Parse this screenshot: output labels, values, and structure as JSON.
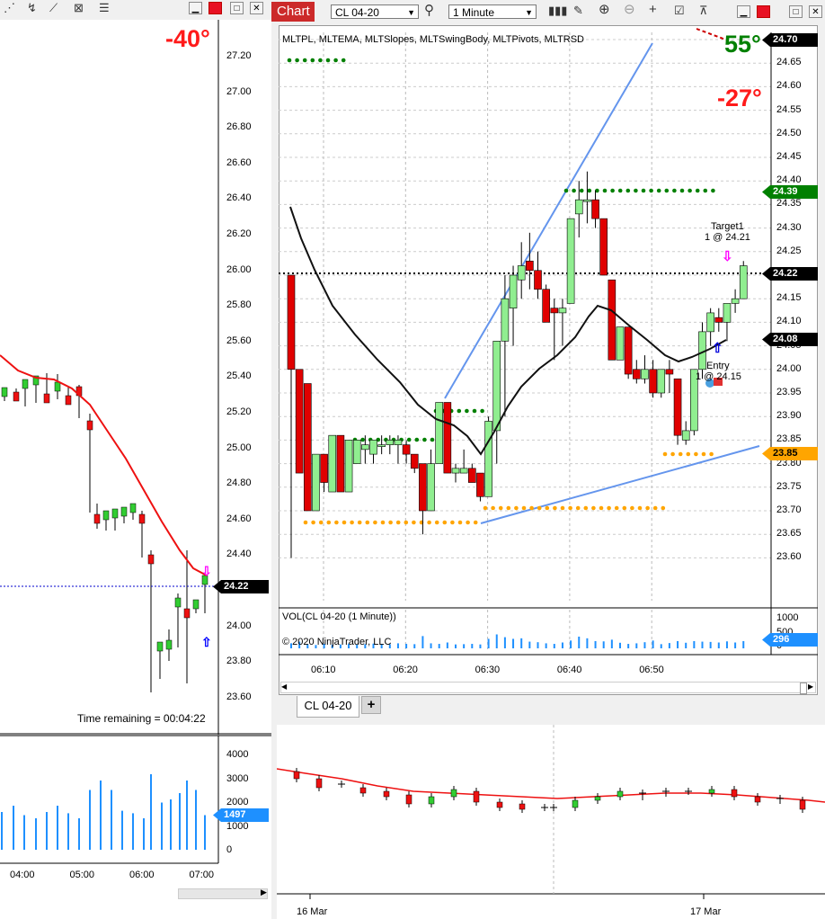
{
  "left_chart": {
    "angle": "-40°",
    "y_ticks": [
      "27.20",
      "27.00",
      "26.80",
      "26.60",
      "26.40",
      "26.20",
      "26.00",
      "25.80",
      "25.60",
      "25.40",
      "25.20",
      "25.00",
      "24.80",
      "24.60",
      "24.40",
      "24.20",
      "24.00",
      "23.80",
      "23.60"
    ],
    "price_label": "24.22",
    "time_remaining": "Time remaining = 00:04:22",
    "vol_ticks": [
      "4000",
      "3000",
      "2000",
      "1000",
      "0"
    ],
    "vol_label": "1497",
    "x_ticks": [
      "04:00",
      "05:00",
      "06:00",
      "07:00"
    ]
  },
  "main_chart": {
    "tab_title": "Chart",
    "instrument": "CL 04-20",
    "interval": "1 Minute",
    "indicators_label": "MLTPL, MLTEMA, MLTSlopes, MLTSwingBody, MLTPivots, MLTRSD",
    "angle_up": "55°",
    "angle_down": "-27°",
    "y_ticks": [
      "24.70",
      "24.65",
      "24.60",
      "24.55",
      "24.50",
      "24.45",
      "24.40",
      "24.35",
      "24.30",
      "24.25",
      "24.20",
      "24.15",
      "24.10",
      "24.05",
      "24.00",
      "23.95",
      "23.90",
      "23.85",
      "23.80",
      "23.75",
      "23.70",
      "23.65",
      "23.60"
    ],
    "price_labels": {
      "top": "24.70",
      "green": "24.39",
      "current": "24.22",
      "black": "24.08",
      "orange": "23.85"
    },
    "target_label": "Target1",
    "target_detail": "1 @ 24.21",
    "entry_label": "Entry",
    "entry_detail": "1 @ 24.15",
    "volume_panel_label": "VOL(CL 04-20 (1 Minute))",
    "copyright": "© 2020 NinjaTrader, LLC",
    "vol_ticks": [
      "1000",
      "500",
      "0"
    ],
    "vol_label": "296",
    "x_ticks": [
      "06:10",
      "06:20",
      "06:30",
      "06:40",
      "06:50"
    ],
    "bottom_tab": "CL 04-20",
    "add_tab": "+",
    "colors": {
      "bull": "#90ee90",
      "bear": "#e00000",
      "accent": "#cc0000",
      "pivot_green": "#008000",
      "pivot_orange": "#ffa500",
      "trendline": "#6495ed",
      "volume": "#1e90ff"
    }
  },
  "bottom_chart": {
    "x_ticks": [
      "16 Mar",
      "17 Mar"
    ]
  },
  "chart_data": [
    {
      "type": "candlestick",
      "title": "CL 04-20 (1 Minute)",
      "ylim": [
        23.55,
        24.72
      ],
      "x_ticks": [
        "06:10",
        "06:20",
        "06:30",
        "06:40",
        "06:50"
      ],
      "candles": [
        {
          "o": 24.2,
          "h": 24.2,
          "l": 23.6,
          "c": 24.0
        },
        {
          "o": 24.0,
          "h": 24.0,
          "l": 23.78,
          "c": 23.78
        },
        {
          "o": 23.97,
          "h": 23.97,
          "l": 23.7,
          "c": 23.7
        },
        {
          "o": 23.7,
          "h": 23.82,
          "l": 23.7,
          "c": 23.82
        },
        {
          "o": 23.82,
          "h": 23.82,
          "l": 23.74,
          "c": 23.76
        },
        {
          "o": 23.74,
          "h": 23.86,
          "l": 23.74,
          "c": 23.86
        },
        {
          "o": 23.86,
          "h": 23.86,
          "l": 23.74,
          "c": 23.74
        },
        {
          "o": 23.74,
          "h": 23.85,
          "l": 23.74,
          "c": 23.85
        },
        {
          "o": 23.8,
          "h": 23.85,
          "l": 23.8,
          "c": 23.85
        },
        {
          "o": 23.83,
          "h": 23.86,
          "l": 23.8,
          "c": 23.84
        },
        {
          "o": 23.82,
          "h": 23.85,
          "l": 23.8,
          "c": 23.85
        },
        {
          "o": 23.84,
          "h": 23.86,
          "l": 23.82,
          "c": 23.84
        },
        {
          "o": 23.84,
          "h": 23.86,
          "l": 23.82,
          "c": 23.85
        },
        {
          "o": 23.84,
          "h": 23.86,
          "l": 23.8,
          "c": 23.85
        },
        {
          "o": 23.84,
          "h": 23.85,
          "l": 23.8,
          "c": 23.82
        },
        {
          "o": 23.82,
          "h": 23.82,
          "l": 23.78,
          "c": 23.79
        },
        {
          "o": 23.8,
          "h": 23.8,
          "l": 23.65,
          "c": 23.7
        },
        {
          "o": 23.7,
          "h": 23.83,
          "l": 23.7,
          "c": 23.8
        },
        {
          "o": 23.8,
          "h": 23.93,
          "l": 23.8,
          "c": 23.93
        },
        {
          "o": 23.93,
          "h": 23.93,
          "l": 23.78,
          "c": 23.78
        },
        {
          "o": 23.78,
          "h": 23.8,
          "l": 23.76,
          "c": 23.79
        },
        {
          "o": 23.78,
          "h": 23.83,
          "l": 23.78,
          "c": 23.79
        },
        {
          "o": 23.79,
          "h": 23.8,
          "l": 23.76,
          "c": 23.76
        },
        {
          "o": 23.78,
          "h": 23.78,
          "l": 23.72,
          "c": 23.73
        },
        {
          "o": 23.73,
          "h": 23.9,
          "l": 23.73,
          "c": 23.89
        },
        {
          "o": 23.87,
          "h": 24.06,
          "l": 23.8,
          "c": 24.06
        },
        {
          "o": 24.06,
          "h": 24.2,
          "l": 23.9,
          "c": 24.15
        },
        {
          "o": 24.13,
          "h": 24.22,
          "l": 24.05,
          "c": 24.2
        },
        {
          "o": 24.19,
          "h": 24.27,
          "l": 24.15,
          "c": 24.22
        },
        {
          "o": 24.23,
          "h": 24.29,
          "l": 24.17,
          "c": 24.21
        },
        {
          "o": 24.21,
          "h": 24.25,
          "l": 24.15,
          "c": 24.17
        },
        {
          "o": 24.17,
          "h": 24.18,
          "l": 24.1,
          "c": 24.1
        },
        {
          "o": 24.13,
          "h": 24.15,
          "l": 24.02,
          "c": 24.12
        },
        {
          "o": 24.12,
          "h": 24.15,
          "l": 24.05,
          "c": 24.13
        },
        {
          "o": 24.14,
          "h": 24.32,
          "l": 24.14,
          "c": 24.32
        },
        {
          "o": 24.33,
          "h": 24.4,
          "l": 24.28,
          "c": 24.36
        },
        {
          "o": 24.36,
          "h": 24.42,
          "l": 24.31,
          "c": 24.36
        },
        {
          "o": 24.36,
          "h": 24.38,
          "l": 24.3,
          "c": 24.32
        },
        {
          "o": 24.32,
          "h": 24.32,
          "l": 24.2,
          "c": 24.2
        },
        {
          "o": 24.19,
          "h": 24.19,
          "l": 24.02,
          "c": 24.02
        },
        {
          "o": 24.02,
          "h": 24.09,
          "l": 24.02,
          "c": 24.09
        },
        {
          "o": 24.09,
          "h": 24.09,
          "l": 23.98,
          "c": 23.99
        },
        {
          "o": 24.0,
          "h": 24.02,
          "l": 23.97,
          "c": 23.98
        },
        {
          "o": 23.98,
          "h": 24.03,
          "l": 23.97,
          "c": 24.0
        },
        {
          "o": 24.0,
          "h": 24.02,
          "l": 23.94,
          "c": 23.95
        },
        {
          "o": 23.95,
          "h": 24.0,
          "l": 23.94,
          "c": 24.0
        },
        {
          "o": 24.0,
          "h": 24.02,
          "l": 23.95,
          "c": 23.99
        },
        {
          "o": 23.98,
          "h": 23.98,
          "l": 23.84,
          "c": 23.86
        },
        {
          "o": 23.85,
          "h": 23.89,
          "l": 23.84,
          "c": 23.87
        },
        {
          "o": 23.87,
          "h": 24.0,
          "l": 23.86,
          "c": 24.0
        },
        {
          "o": 24.0,
          "h": 24.1,
          "l": 23.98,
          "c": 24.08
        },
        {
          "o": 24.08,
          "h": 24.13,
          "l": 24.05,
          "c": 24.12
        },
        {
          "o": 24.11,
          "h": 24.13,
          "l": 24.08,
          "c": 24.1
        },
        {
          "o": 24.1,
          "h": 24.14,
          "l": 24.06,
          "c": 24.14
        },
        {
          "o": 24.14,
          "h": 24.17,
          "l": 24.12,
          "c": 24.15
        },
        {
          "o": 24.15,
          "h": 24.23,
          "l": 24.15,
          "c": 24.22
        }
      ],
      "volume": [
        180,
        240,
        150,
        120,
        160,
        130,
        140,
        170,
        130,
        150,
        170,
        160,
        150,
        180,
        160,
        150,
        440,
        180,
        160,
        210,
        140,
        150,
        160,
        140,
        340,
        500,
        400,
        340,
        360,
        240,
        220,
        180,
        160,
        210,
        280,
        420,
        360,
        260,
        250,
        310,
        200,
        160,
        180,
        220,
        280,
        150,
        190,
        260,
        200,
        260,
        240,
        230,
        210,
        250,
        210,
        260
      ],
      "vol_ylim": [
        0,
        1000
      ]
    }
  ]
}
